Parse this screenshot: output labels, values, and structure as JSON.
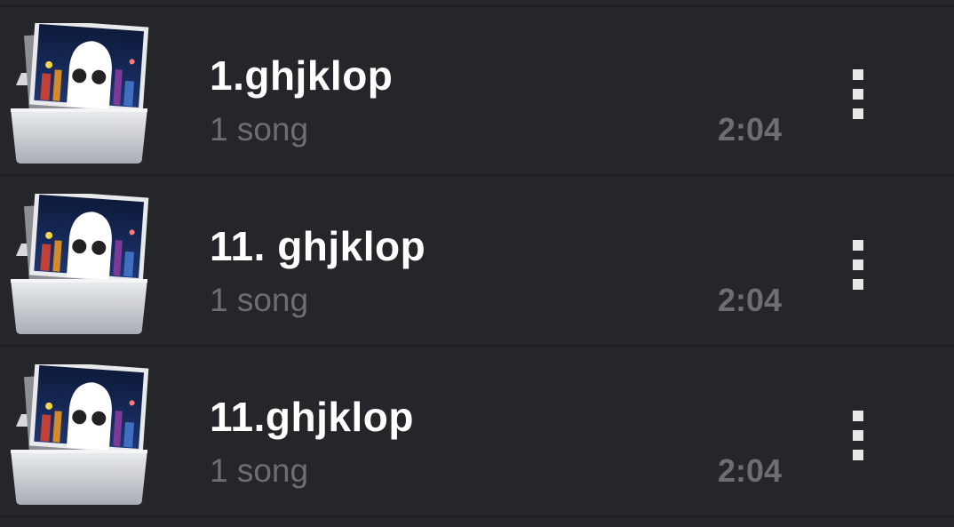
{
  "items": [
    {
      "title": "1.ghjklop",
      "subtitle": "1 song",
      "duration": "2:04",
      "icon": "folder-artwork-icon"
    },
    {
      "title": "11. ghjklop",
      "subtitle": "1 song",
      "duration": "2:04",
      "icon": "folder-artwork-icon"
    },
    {
      "title": "11.ghjklop",
      "subtitle": "1 song",
      "duration": "2:04",
      "icon": "folder-artwork-icon"
    }
  ],
  "colors": {
    "background": "#25262a",
    "title": "#ffffff",
    "secondary": "#6d6e72",
    "divider": "#1c1d20"
  }
}
